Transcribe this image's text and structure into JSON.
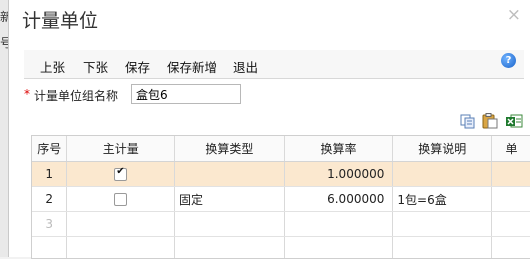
{
  "background_window": {
    "fragments": [
      "新",
      "号"
    ]
  },
  "dialog": {
    "title": "计量单位",
    "close_glyph": "×"
  },
  "toolbar": {
    "prev_label": "上张",
    "next_label": "下张",
    "save_label": "保存",
    "save_new_label": "保存新增",
    "exit_label": "退出",
    "help_glyph": "?"
  },
  "form": {
    "required_mark": "*",
    "group_name_label": "计量单位组名称",
    "group_name_value": "盒包6"
  },
  "grid_tools": [
    "copy-icon",
    "paste-icon",
    "export-excel-icon"
  ],
  "grid": {
    "columns": [
      "序号",
      "主计量",
      "换算类型",
      "换算率",
      "换算说明",
      "单"
    ],
    "rows": [
      {
        "index": "1",
        "main_unit": true,
        "conv_type": "",
        "rate": "1.000000",
        "desc": ""
      },
      {
        "index": "2",
        "main_unit": false,
        "conv_type": "固定",
        "rate": "6.000000",
        "desc": "1包=6盒"
      },
      {
        "index": "3",
        "main_unit": null,
        "conv_type": "",
        "rate": "",
        "desc": ""
      }
    ]
  },
  "colors": {
    "selected_row": "#fbe8cf",
    "required": "#dd0000",
    "help_blue": "#1a63c9"
  }
}
